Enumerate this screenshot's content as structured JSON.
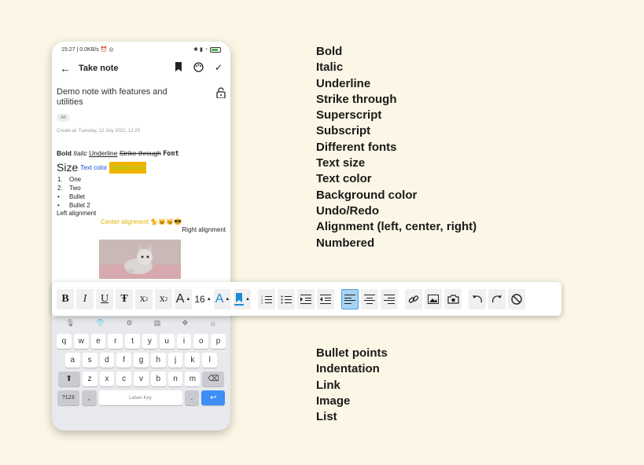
{
  "status": {
    "time": "15:27",
    "speed": "0.0KB/s"
  },
  "appbar": {
    "title": "Take note"
  },
  "note": {
    "title": "Demo note with features and utilities",
    "tag": "All",
    "created": "Create at: Tuesday, 12 July 2022, 12:29",
    "bold": "Bold",
    "italic": "Italic",
    "underline": "Underline",
    "strike": "Strike through",
    "font": "Font",
    "size": "Size",
    "text_color": "Text color",
    "background": "Background",
    "list": [
      {
        "marker": "1.",
        "text": "One"
      },
      {
        "marker": "2.",
        "text": "Two"
      },
      {
        "marker": "•",
        "text": "Bullet"
      },
      {
        "marker": "•",
        "text": "Bullet 2"
      }
    ],
    "left": "Left alignment",
    "center": "Center alignment 🐈😺😼😎",
    "right": "Right alignment"
  },
  "keyboard": {
    "row1": [
      "q",
      "w",
      "e",
      "r",
      "t",
      "y",
      "u",
      "i",
      "o",
      "p"
    ],
    "row2": [
      "a",
      "s",
      "d",
      "f",
      "g",
      "h",
      "j",
      "k",
      "l"
    ],
    "row3": [
      "z",
      "x",
      "c",
      "v",
      "b",
      "n",
      "m"
    ],
    "symbols": "?123",
    "comma": ",",
    "space": "Laban Key",
    "period": "."
  },
  "toolbar": {
    "font_size": "16"
  },
  "features_top": [
    "Bold",
    "Italic",
    "Underline",
    "Strike through",
    "Superscript",
    "Subscript",
    "Different fonts",
    "Text size",
    "Text color",
    "Background color",
    "Undo/Redo",
    "Alignment (left, center, right)",
    "Numbered"
  ],
  "features_bottom": [
    "Bullet points",
    "Indentation",
    "Link",
    "Image",
    "List"
  ]
}
